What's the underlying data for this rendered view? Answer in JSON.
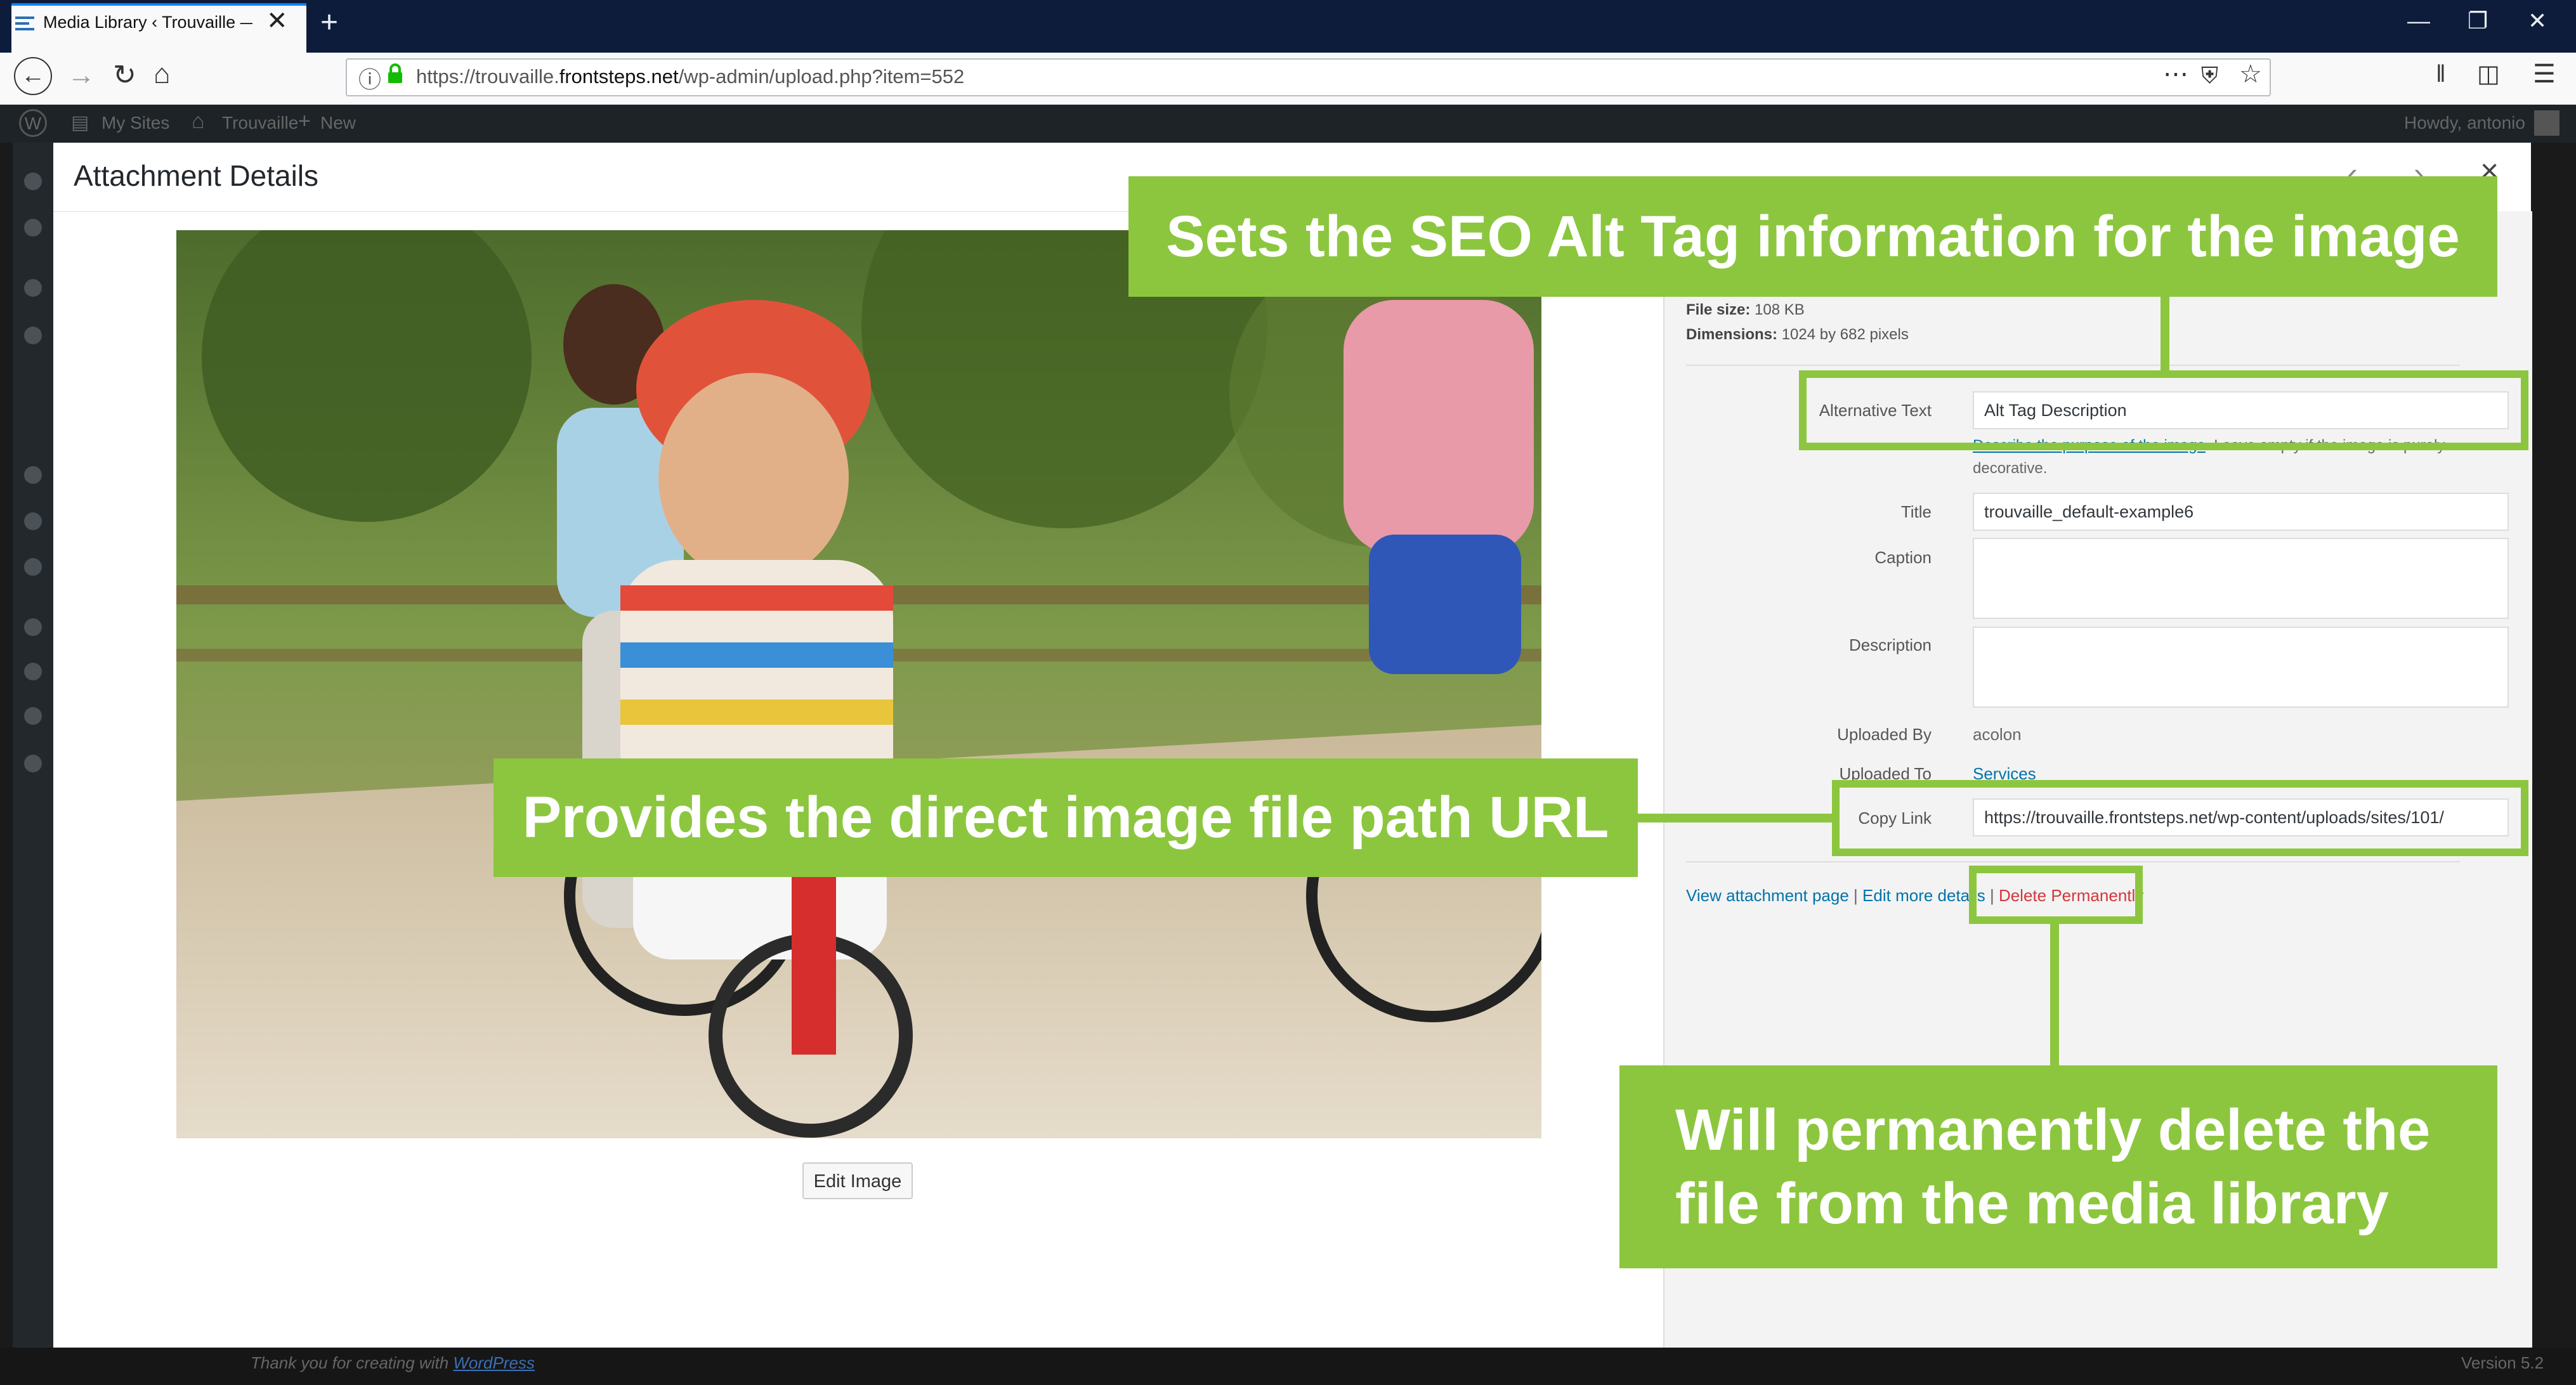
{
  "browser": {
    "tab_title": "Media Library ‹ Trouvaille — W",
    "tab_close": "✕",
    "new_tab": "+",
    "url_prefix": "https://trouvaille.",
    "url_domain": "frontsteps.net",
    "url_path": "/wp-admin/upload.php?item=552",
    "icons": [
      "back-icon",
      "forward-icon",
      "reload-icon",
      "home-icon",
      "info-icon",
      "lock-icon",
      "more-icon",
      "pocket-icon",
      "bookmark-star-icon",
      "library-icon",
      "sidebar-icon",
      "menu-icon",
      "minimize-icon",
      "restore-icon",
      "window-close-icon"
    ]
  },
  "admin_bar": {
    "my_sites": "My Sites",
    "site_name": "Trouvaille",
    "new": "New",
    "howdy": "Howdy, antonio"
  },
  "modal": {
    "title": "Attachment Details",
    "edit_image": "Edit Image",
    "file_size_label": "File size:",
    "file_size_value": "108 KB",
    "dimensions_label": "Dimensions:",
    "dimensions_value": "1024 by 682 pixels",
    "fields": {
      "alt_text_label": "Alternative Text",
      "alt_text_value": "Alt Tag Description",
      "alt_help_link": "Describe the purpose of the image",
      "alt_help_rest": ". Leave empty if the image is purely decorative.",
      "title_label": "Title",
      "title_value": "trouvaille_default-example6",
      "caption_label": "Caption",
      "description_label": "Description",
      "uploaded_by_label": "Uploaded By",
      "uploaded_by_value": "acolon",
      "uploaded_to_label": "Uploaded To",
      "uploaded_to_value": "Services",
      "copy_link_label": "Copy Link",
      "copy_link_value": "https://trouvaille.frontsteps.net/wp-content/uploads/sites/101/"
    },
    "actions": {
      "view_attachment": "View attachment page",
      "separator": "|",
      "edit_more": "Edit more details",
      "delete": "Delete Permanently"
    }
  },
  "callouts": {
    "alt": "Sets the SEO Alt Tag information for the image",
    "url": "Provides the direct image file path URL",
    "delete_line1": "Will permanently delete the",
    "delete_line2": "file from the media library"
  },
  "footer": {
    "thanks_prefix": "Thank you for creating with ",
    "thanks_link": "WordPress",
    "version": "Version 5.2"
  },
  "colors": {
    "callout_green": "#8cc63f",
    "link_blue": "#0073aa",
    "delete_red": "#d63638",
    "tabbar_bg": "#0c1c3a",
    "adminbar_bg": "#1d2327"
  }
}
